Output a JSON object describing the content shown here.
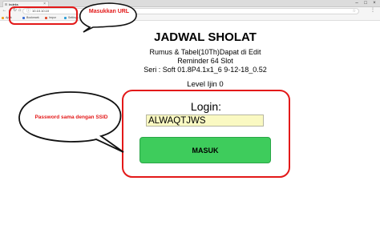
{
  "browser": {
    "tab_title": "Indeks",
    "tab_close": "×",
    "window_controls": {
      "minimize": "–",
      "maximize": "□",
      "close": "×"
    },
    "nav": {
      "back": "←",
      "forward": "→",
      "reload": "↻",
      "home": "⌂"
    },
    "address_icon": "ⓘ",
    "url": "10.10.10.10",
    "star": "☆",
    "menu": "⋮",
    "bookmarks": [
      {
        "label": "Aplik",
        "color": "#f0a020"
      },
      {
        "label": "Bookmark",
        "color": "#3b6fd8"
      },
      {
        "label": "Impor",
        "color": "#e04a2b"
      },
      {
        "label": "Settings",
        "color": "#2aa0d8"
      }
    ]
  },
  "page": {
    "title": "JADWAL SHOLAT",
    "line1": "Rumus & Tabel(10Th)Dapat di Edit",
    "line2": "Reminder 64 Slot",
    "line3": "Seri : Soft 01.8P4.1x1_6 9-12-18_0.52",
    "level": "Level Ijin 0"
  },
  "login": {
    "title": "Login:",
    "password_value": "ALWAQTJWS",
    "button_label": "MASUK"
  },
  "annotations": {
    "url_note": "Masukkan URL",
    "password_note": "Password sama dengan SSID",
    "accent_color": "#e31919"
  }
}
